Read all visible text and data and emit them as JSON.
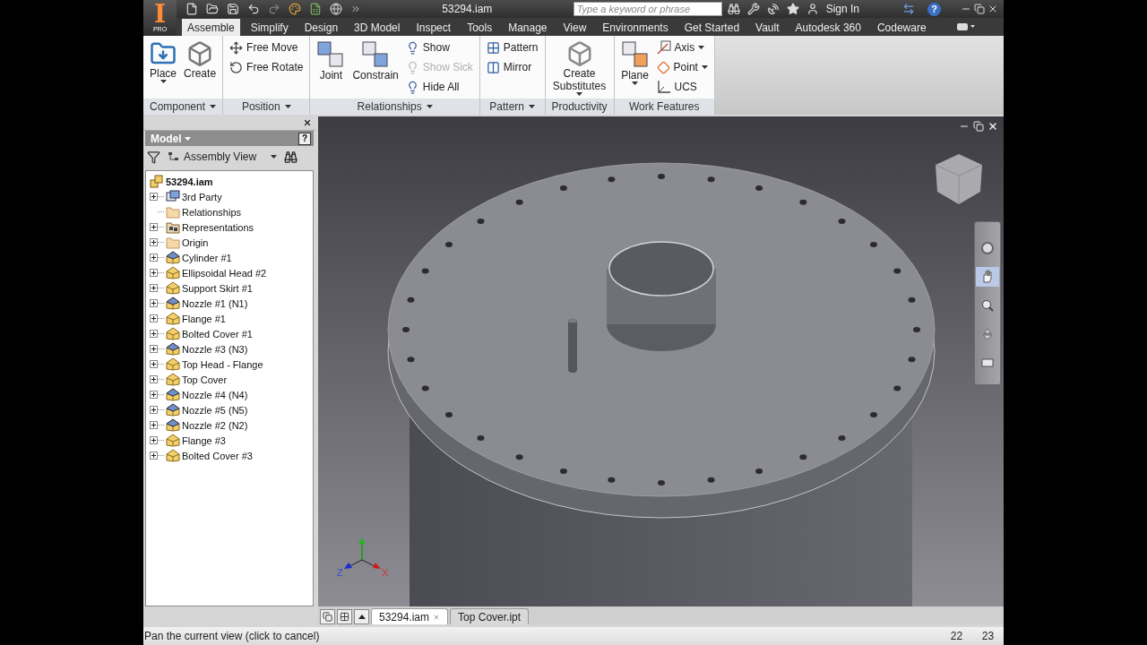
{
  "app_button": {
    "logo_letter": "I",
    "edition": "PRO"
  },
  "title_bar": {
    "document_title": "53294.iam",
    "search": {
      "placeholder": "Type a keyword or phrase"
    },
    "sign_in": "Sign In",
    "help": "?"
  },
  "ribbon_tabs": [
    {
      "label": "Assemble",
      "selected": true
    },
    {
      "label": "Simplify",
      "selected": false
    },
    {
      "label": "Design",
      "selected": false
    },
    {
      "label": "3D Model",
      "selected": false
    },
    {
      "label": "Inspect",
      "selected": false
    },
    {
      "label": "Tools",
      "selected": false
    },
    {
      "label": "Manage",
      "selected": false
    },
    {
      "label": "View",
      "selected": false
    },
    {
      "label": "Environments",
      "selected": false
    },
    {
      "label": "Get Started",
      "selected": false
    },
    {
      "label": "Vault",
      "selected": false
    },
    {
      "label": "Autodesk 360",
      "selected": false
    },
    {
      "label": "Codeware",
      "selected": false
    }
  ],
  "ribbon_panels": [
    {
      "label": "Component",
      "dropdown": true,
      "buttons": [
        {
          "kind": "large",
          "label": "Place",
          "caret": true,
          "disabled": false
        },
        {
          "kind": "large",
          "label": "Create",
          "caret": false,
          "disabled": false
        }
      ]
    },
    {
      "label": "Position",
      "dropdown": true,
      "buttons": [
        {
          "kind": "small",
          "label": "Free Move",
          "caret": false,
          "disabled": false
        },
        {
          "kind": "small",
          "label": "Free Rotate",
          "caret": false,
          "disabled": false
        }
      ]
    },
    {
      "label": "Relationships",
      "dropdown": true,
      "buttons": [
        {
          "kind": "large",
          "label": "Joint",
          "caret": false,
          "disabled": false
        },
        {
          "kind": "large",
          "label": "Constrain",
          "caret": false,
          "disabled": false
        },
        {
          "kind": "small",
          "label": "Show",
          "caret": false,
          "disabled": false
        },
        {
          "kind": "small",
          "label": "Show Sick",
          "caret": false,
          "disabled": true
        },
        {
          "kind": "small",
          "label": "Hide All",
          "caret": false,
          "disabled": false
        }
      ]
    },
    {
      "label": "Pattern",
      "dropdown": true,
      "buttons": [
        {
          "kind": "small",
          "label": "Pattern",
          "caret": false,
          "disabled": false
        },
        {
          "kind": "small",
          "label": "Mirror",
          "caret": false,
          "disabled": false
        }
      ]
    },
    {
      "label": "Productivity",
      "dropdown": false,
      "buttons": [
        {
          "kind": "large",
          "label": "Create Substitutes",
          "caret": true,
          "disabled": false
        }
      ]
    },
    {
      "label": "Work Features",
      "dropdown": false,
      "buttons": [
        {
          "kind": "large",
          "label": "Plane",
          "caret": true,
          "disabled": false
        },
        {
          "kind": "small",
          "label": "Axis",
          "caret": true,
          "disabled": false
        },
        {
          "kind": "small",
          "label": "Point",
          "caret": true,
          "disabled": false
        },
        {
          "kind": "small",
          "label": "UCS",
          "caret": false,
          "disabled": false
        }
      ]
    }
  ],
  "browser": {
    "title": "Model",
    "help": "?",
    "view": "Assembly View",
    "tree": {
      "label": "53294.iam",
      "children": [
        {
          "label": "3rd Party",
          "kind": "link",
          "expandable": true
        },
        {
          "label": "Relationships",
          "kind": "folder",
          "expandable": false
        },
        {
          "label": "Representations",
          "kind": "views",
          "expandable": true
        },
        {
          "label": "Origin",
          "kind": "folder",
          "expandable": true
        },
        {
          "label": "Cylinder #1",
          "kind": "pipe",
          "expandable": true
        },
        {
          "label": "Ellipsoidal Head #2",
          "kind": "part",
          "expandable": true
        },
        {
          "label": "Support Skirt #1",
          "kind": "part",
          "expandable": true
        },
        {
          "label": "Nozzle #1 (N1)",
          "kind": "pipe",
          "expandable": true
        },
        {
          "label": "Flange #1",
          "kind": "part",
          "expandable": true
        },
        {
          "label": "Bolted Cover #1",
          "kind": "part",
          "expandable": true
        },
        {
          "label": "Nozzle #3 (N3)",
          "kind": "pipe",
          "expandable": true
        },
        {
          "label": "Top Head - Flange",
          "kind": "part",
          "expandable": true
        },
        {
          "label": "Top Cover",
          "kind": "part",
          "expandable": true
        },
        {
          "label": "Nozzle #4 (N4)",
          "kind": "pipe",
          "expandable": true
        },
        {
          "label": "Nozzle #5 (N5)",
          "kind": "pipe",
          "expandable": true
        },
        {
          "label": "Nozzle #2 (N2)",
          "kind": "pipe",
          "expandable": true
        },
        {
          "label": "Flange #3",
          "kind": "part",
          "expandable": true
        },
        {
          "label": "Bolted Cover #3",
          "kind": "part",
          "expandable": true
        }
      ]
    }
  },
  "viewport": {
    "triad": {
      "x": "X",
      "z": "Z"
    },
    "navigation_tools": [
      {
        "selected": false
      },
      {
        "selected": true
      },
      {
        "selected": false
      },
      {
        "selected": false
      },
      {
        "selected": false
      }
    ]
  },
  "document_tabs": [
    {
      "label": "53294.iam",
      "selected": true
    },
    {
      "label": "Top Cover.ipt",
      "selected": false
    }
  ],
  "status_bar": {
    "message": "Pan the current view (click to cancel)",
    "cells": [
      "22",
      "23"
    ]
  }
}
